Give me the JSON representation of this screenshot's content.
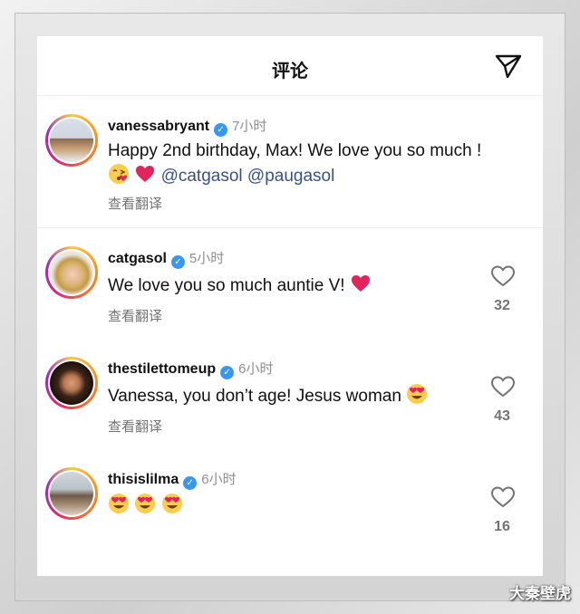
{
  "header": {
    "title": "评论",
    "send_icon": "send-icon"
  },
  "comments": [
    {
      "username": "vanessabryant",
      "verified": true,
      "time": "7小时",
      "text": "Happy 2nd birthday, Max! We love you so much !",
      "text_line2_emoji": [
        "kissing-heart-emoji",
        "red-heart-emoji"
      ],
      "mentions": [
        "@catgasol",
        "@paugasol"
      ],
      "translate_label": "查看翻译"
    },
    {
      "username": "catgasol",
      "verified": true,
      "time": "5小时",
      "text": "We love you so much auntie V!",
      "trailing_emoji": "red-heart-emoji",
      "translate_label": "查看翻译",
      "likes": "32"
    },
    {
      "username": "thestilettomeup",
      "verified": true,
      "time": "6小时",
      "text": "Vanessa, you don’t age! Jesus woman",
      "trailing_emoji": "heart-eyes-emoji",
      "translate_label": "查看翻译",
      "likes": "43"
    },
    {
      "username": "thisislilma",
      "verified": true,
      "time": "6小时",
      "emojis": [
        "heart-eyes-emoji",
        "heart-eyes-emoji",
        "heart-eyes-emoji"
      ],
      "likes": "16"
    }
  ],
  "watermark": "大秦壁虎",
  "colors": {
    "verified": "#3897f0",
    "mention": "#385185",
    "heart": "#e0245e",
    "secondary_text": "#737373"
  }
}
